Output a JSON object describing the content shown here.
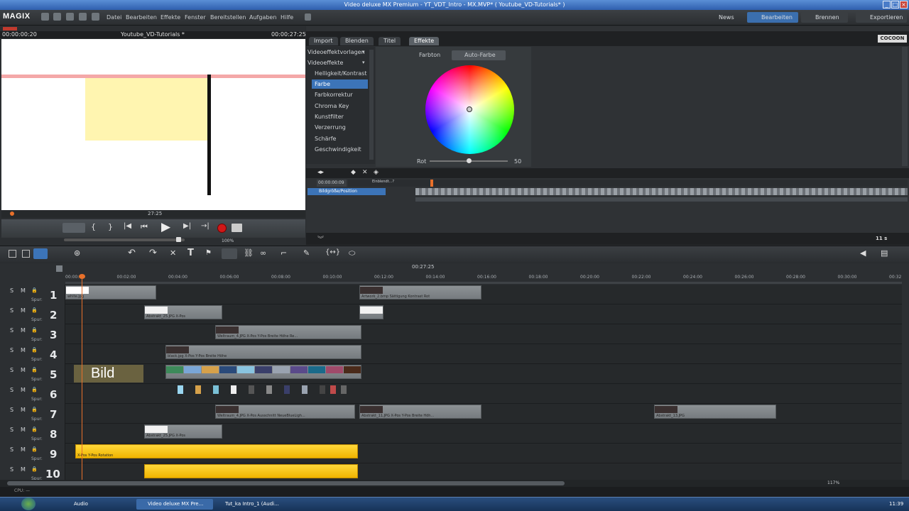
{
  "window": {
    "title": "Video deluxe MX Premium - YT_VDT_Intro - MX.MVP* ( Youtube_VD-Tutorials* )"
  },
  "app": {
    "logo": "MAGIX"
  },
  "menu": [
    "Datei",
    "Bearbeiten",
    "Effekte",
    "Fenster",
    "Bereitstellen",
    "Aufgaben",
    "Hilfe"
  ],
  "header": {
    "news": "News",
    "bearbeiten": "Bearbeiten",
    "brennen": "Brennen",
    "exportieren": "Exportieren"
  },
  "preview": {
    "timecode_left": "00:00:00:20",
    "title": "Youtube_VD-Tutorials *",
    "timecode_right": "00:00:27:25",
    "scrub_label": "27:25",
    "zoom": "100%"
  },
  "tabs": [
    "Import",
    "Blenden",
    "Titel",
    "Effekte"
  ],
  "active_tab": "Effekte",
  "cocoon": "COCOON",
  "effects": {
    "group1": "Videoeffektvorlagen",
    "group2": "Videoeffekte",
    "items": [
      "Helligkeit/Kontrast",
      "Farbe",
      "Farbkorrektur",
      "Chroma Key",
      "Kunstfilter",
      "Verzerrung",
      "Schärfe",
      "Geschwindigkeit"
    ],
    "selected": "Farbe"
  },
  "colorpanel": {
    "farbton": "Farbton",
    "auto_button": "Auto-Farbe",
    "rot_label": "Rot",
    "rot_value": "50",
    "rot_fraction": 0.5
  },
  "keyframe": {
    "timecode": "00:00:00:09",
    "einblenden": "Einblendt...?",
    "track_label": "Bildgröße/Position",
    "duration": "11 s"
  },
  "timeline": {
    "ruler_center": "00:27:25",
    "ticks": [
      "00:00:00",
      "00:02:00",
      "00:04:00",
      "00:06:00",
      "00:08:00",
      "00:10:00",
      "00:12:00",
      "00:14:00",
      "00:16:00",
      "00:18:00",
      "00:20:00",
      "00:22:00",
      "00:24:00",
      "00:26:00",
      "00:28:00",
      "00:30:00",
      "00:32"
    ],
    "tracks": [
      "1",
      "2",
      "3",
      "4",
      "5",
      "6",
      "7",
      "8",
      "9",
      "10"
    ],
    "s_label": "S",
    "m_label": "M",
    "spur_label": "Spur:",
    "bild_overlay": "Bild",
    "clips": {
      "c1": "white.jpg",
      "c1b": "Artwork_2.bmp   Sättigung   Kontrast   Rot",
      "c2": "Abstrakt_25.JPG   X-Pos",
      "c3": "Weltraum_4.JPG   X-Pos   Y-Pos   Breite   Höhe   Re...",
      "c4": "black.jpg   X-Pos   Y-Pos   Breite   Höhe",
      "c7": "Weltraum_4.JPG   X-Pos   Ausschnitt   NeueBlueLigh...",
      "c7b": "Abstrakt_11.JPG   X-Pos   Y-Pos   Breite   Höh...",
      "c7c": "Abstrakt_13.JPG",
      "c8": "Abstrakt_25.JPG   X-Pos",
      "c9": "X-Pos   Y-Pos   Rotation"
    },
    "zoom": "117%",
    "cpu": "CPU: —"
  },
  "taskbar": {
    "items": [
      "Audio",
      "Video deluxe MX Pre...",
      "Tut_ka Intro_1 (Audi..."
    ],
    "clock": "11:39"
  },
  "colors": {
    "accent": "#3c74b8",
    "yellow_clip": "#f4c10c",
    "playhead": "#e8702a",
    "record": "#d01818"
  }
}
